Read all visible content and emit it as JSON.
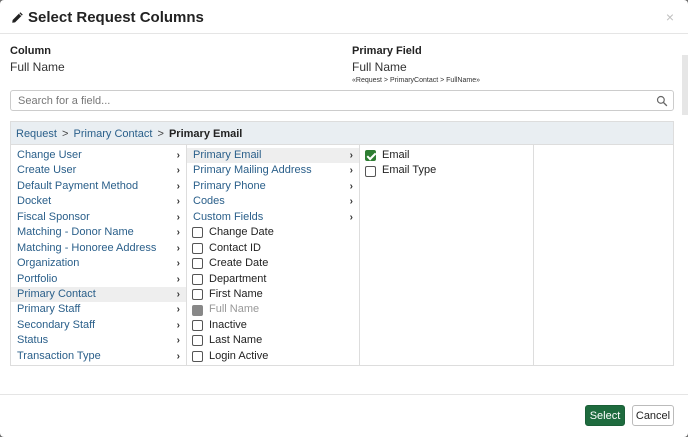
{
  "modal": {
    "title": "Select Request Columns",
    "close": "×"
  },
  "info": {
    "column_label": "Column",
    "column_value": "Full Name",
    "primary_label": "Primary Field",
    "primary_value": "Full Name",
    "primary_path": "«Request > PrimaryContact > FullName»"
  },
  "search": {
    "placeholder": "Search for a field..."
  },
  "breadcrumb": {
    "items": [
      "Request",
      "Primary Contact"
    ],
    "separator": ">",
    "current": "Primary Email"
  },
  "col1": [
    {
      "label": "Change User",
      "chevron": true
    },
    {
      "label": "Create User",
      "chevron": true
    },
    {
      "label": "Default Payment Method",
      "chevron": true
    },
    {
      "label": "Docket",
      "chevron": true
    },
    {
      "label": "Fiscal Sponsor",
      "chevron": true
    },
    {
      "label": "Matching - Donor Name",
      "chevron": true
    },
    {
      "label": "Matching - Honoree Address",
      "chevron": true
    },
    {
      "label": "Organization",
      "chevron": true
    },
    {
      "label": "Portfolio",
      "chevron": true
    },
    {
      "label": "Primary Contact",
      "chevron": true,
      "active": true
    },
    {
      "label": "Primary Staff",
      "chevron": true
    },
    {
      "label": "Secondary Staff",
      "chevron": true
    },
    {
      "label": "Status",
      "chevron": true
    },
    {
      "label": "Transaction Type",
      "chevron": true
    }
  ],
  "col2_links": [
    {
      "label": "Primary Email",
      "chevron": true,
      "active": true
    },
    {
      "label": "Primary Mailing Address",
      "chevron": true
    },
    {
      "label": "Primary Phone",
      "chevron": true
    },
    {
      "label": "Codes",
      "chevron": true
    },
    {
      "label": "Custom Fields",
      "chevron": true
    }
  ],
  "col2_checks": [
    {
      "label": "Change Date",
      "state": "unchecked"
    },
    {
      "label": "Contact ID",
      "state": "unchecked"
    },
    {
      "label": "Create Date",
      "state": "unchecked"
    },
    {
      "label": "Department",
      "state": "unchecked"
    },
    {
      "label": "First Name",
      "state": "unchecked"
    },
    {
      "label": "Full Name",
      "state": "disabled"
    },
    {
      "label": "Inactive",
      "state": "unchecked"
    },
    {
      "label": "Last Name",
      "state": "unchecked"
    },
    {
      "label": "Login Active",
      "state": "unchecked"
    }
  ],
  "col3_checks": [
    {
      "label": "Email",
      "state": "checked"
    },
    {
      "label": "Email Type",
      "state": "unchecked"
    }
  ],
  "footer": {
    "select_label": "Select",
    "cancel_label": "Cancel"
  },
  "colors": {
    "link": "#2a5f8a",
    "primary_button": "#1e6b3e",
    "checkbox_checked": "#2e7d32",
    "breadcrumb_bg": "#e9eef2"
  },
  "icons": {
    "title": "pencil-icon",
    "search": "search-icon",
    "chevron": "chevron-right-icon"
  }
}
